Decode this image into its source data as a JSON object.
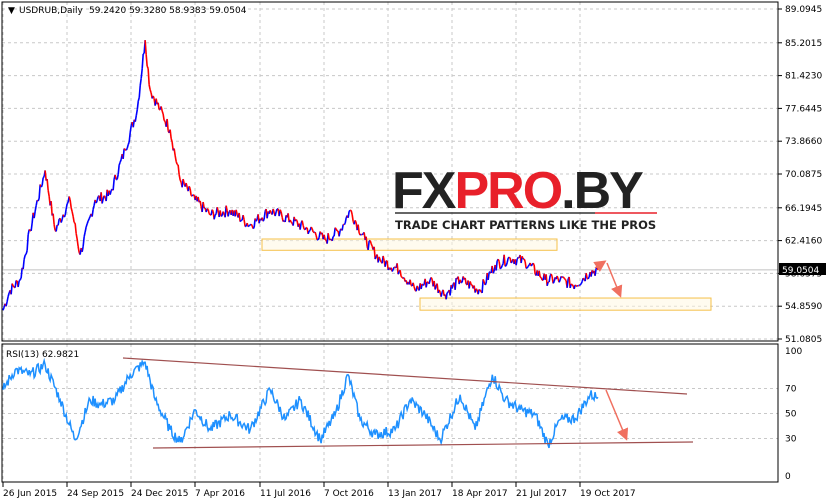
{
  "header": {
    "symbol": "USDRUB,Daily",
    "ohlc": "59.2420 59.3280 58.9383 59.0504"
  },
  "rsi_header": {
    "label": "RSI(13) 62.9821"
  },
  "current_price_label": "59.0504",
  "watermark": {
    "brand": "FXPRO.BY",
    "tagline": "TRADE CHART PATTERNS LIKE THE PROS"
  },
  "colors": {
    "up": "#0000ff",
    "down": "#ff0000",
    "rsi": "#1e90ff",
    "trendline": "#a05050",
    "zone": "#f5c04a",
    "arrow": "#f07060"
  },
  "chart_data": [
    {
      "type": "line",
      "title": "USDRUB,Daily",
      "x_unit": "days since 26 Jun 2015",
      "ylim": [
        51.0805,
        89.0945
      ],
      "y_ticks": [
        "89.0945",
        "85.2015",
        "81.4230",
        "77.6445",
        "73.8660",
        "70.0875",
        "66.1945",
        "62.4160",
        "58.6375",
        "54.8590",
        "51.0805"
      ],
      "x_ticks": [
        "26 Jun 2015",
        "24 Sep 2015",
        "24 Dec 2015",
        "7 Apr 2016",
        "11 Jul 2016",
        "7 Oct 2016",
        "13 Jan 2017",
        "18 Apr 2017",
        "21 Jul 2017",
        "19 Oct 2017"
      ],
      "points": [
        [
          0,
          54.4
        ],
        [
          10,
          56.7
        ],
        [
          24,
          57.9
        ],
        [
          38,
          63.6
        ],
        [
          59,
          70.5
        ],
        [
          73,
          63.6
        ],
        [
          94,
          67.1
        ],
        [
          108,
          60.8
        ],
        [
          129,
          67.1
        ],
        [
          150,
          67.7
        ],
        [
          171,
          72.9
        ],
        [
          188,
          77.5
        ],
        [
          199,
          85.5
        ],
        [
          206,
          79.8
        ],
        [
          220,
          77.5
        ],
        [
          234,
          75.2
        ],
        [
          248,
          69.4
        ],
        [
          269,
          67.1
        ],
        [
          290,
          65.4
        ],
        [
          318,
          65.9
        ],
        [
          346,
          64.2
        ],
        [
          374,
          65.9
        ],
        [
          402,
          64.8
        ],
        [
          430,
          63.6
        ],
        [
          451,
          62.5
        ],
        [
          472,
          63.6
        ],
        [
          486,
          65.9
        ],
        [
          507,
          62.5
        ],
        [
          528,
          60.2
        ],
        [
          556,
          59.0
        ],
        [
          577,
          56.7
        ],
        [
          598,
          57.9
        ],
        [
          619,
          56.2
        ],
        [
          640,
          57.9
        ],
        [
          668,
          56.7
        ],
        [
          689,
          59.6
        ],
        [
          710,
          60.4
        ],
        [
          731,
          60.0
        ],
        [
          759,
          57.9
        ],
        [
          780,
          57.9
        ],
        [
          801,
          57.3
        ],
        [
          822,
          58.8
        ],
        [
          833,
          59.05
        ]
      ],
      "zones": [
        [
          61.3,
          62.6
        ],
        [
          54.4,
          55.8
        ]
      ]
    },
    {
      "type": "line",
      "title": "RSI(13) 62.9821",
      "ylim": [
        0,
        100
      ],
      "y_ticks": [
        "100",
        "70",
        "50",
        "30",
        "0"
      ],
      "points": [
        [
          0,
          69
        ],
        [
          17,
          85
        ],
        [
          38,
          81
        ],
        [
          59,
          89
        ],
        [
          80,
          61
        ],
        [
          101,
          29
        ],
        [
          122,
          61
        ],
        [
          136,
          57
        ],
        [
          157,
          61
        ],
        [
          178,
          81
        ],
        [
          199,
          91
        ],
        [
          213,
          61
        ],
        [
          234,
          37
        ],
        [
          248,
          27
        ],
        [
          269,
          53
        ],
        [
          290,
          37
        ],
        [
          318,
          49
        ],
        [
          346,
          37
        ],
        [
          374,
          69
        ],
        [
          395,
          45
        ],
        [
          416,
          61
        ],
        [
          444,
          29
        ],
        [
          465,
          49
        ],
        [
          483,
          81
        ],
        [
          500,
          45
        ],
        [
          521,
          33
        ],
        [
          549,
          37
        ],
        [
          570,
          61
        ],
        [
          591,
          49
        ],
        [
          612,
          29
        ],
        [
          640,
          65
        ],
        [
          661,
          37
        ],
        [
          685,
          81
        ],
        [
          703,
          61
        ],
        [
          724,
          53
        ],
        [
          745,
          49
        ],
        [
          763,
          25
        ],
        [
          780,
          45
        ],
        [
          801,
          46
        ],
        [
          822,
          65
        ],
        [
          833,
          63
        ]
      ]
    }
  ]
}
